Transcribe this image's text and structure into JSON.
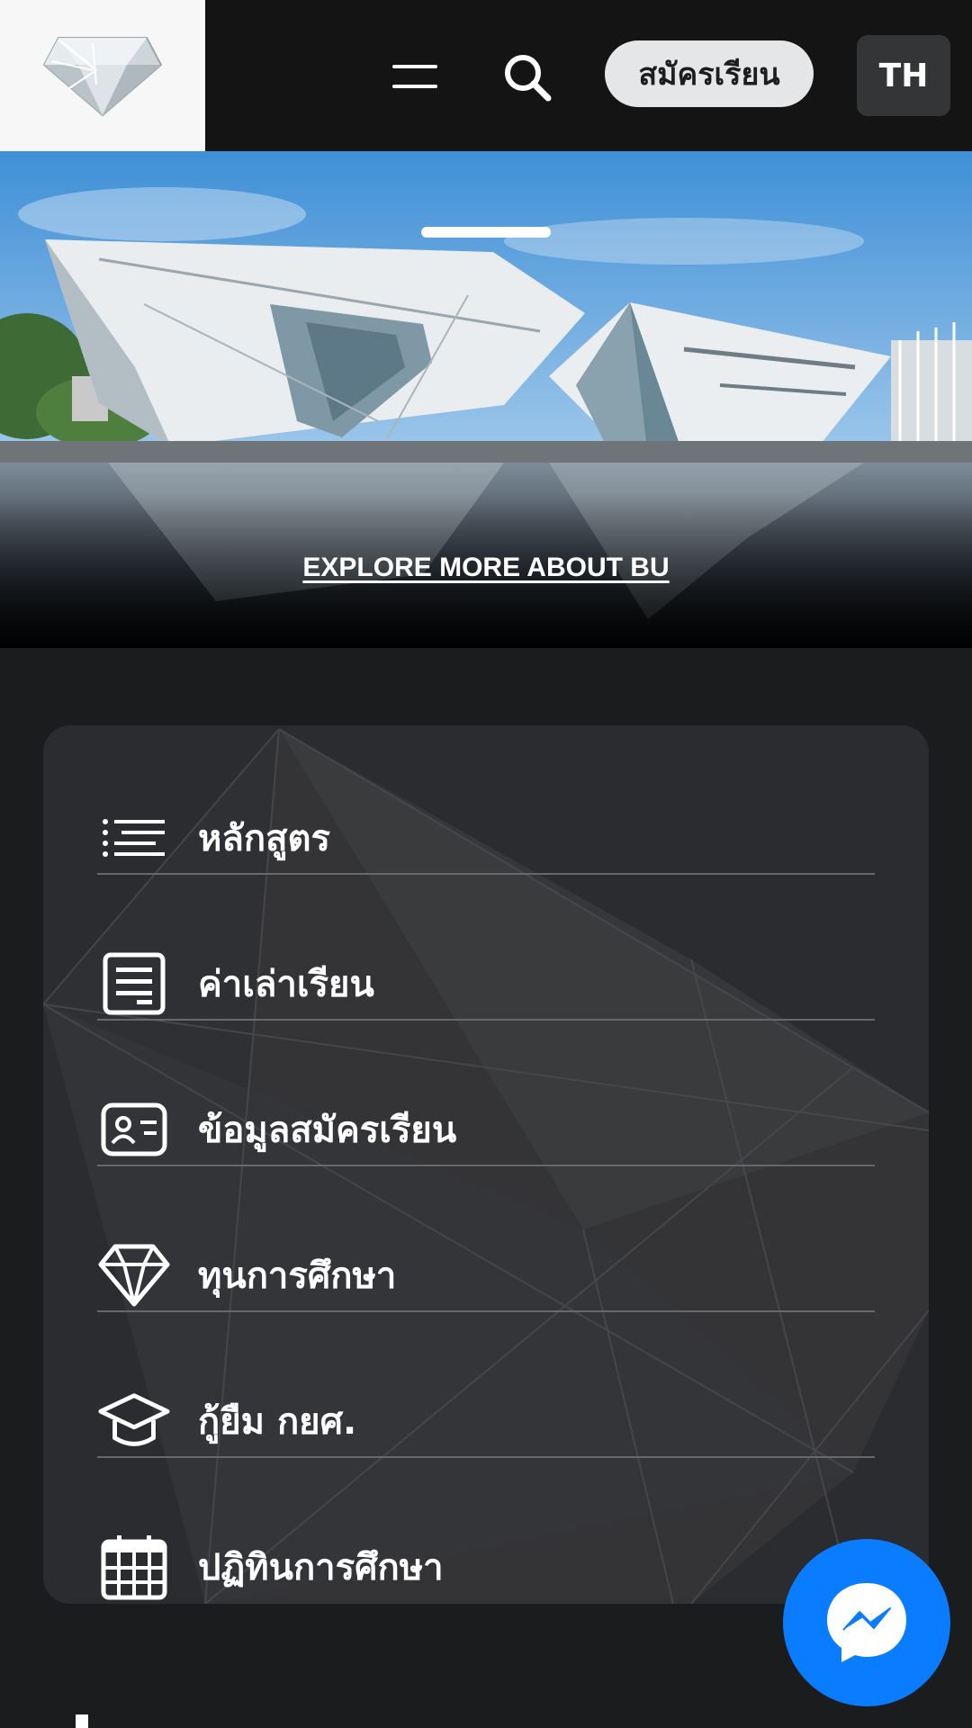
{
  "header": {
    "logo": "diamond-logo-icon",
    "menu_icon": "hamburger-menu-icon",
    "search_icon": "search-icon",
    "apply_label": "สมัครเรียน",
    "lang_label": "TH"
  },
  "hero": {
    "explore_label": "EXPLORE MORE ABOUT BU",
    "active_slide": 1
  },
  "quick_menu": {
    "items": [
      {
        "label": "หลักสูตร",
        "icon": "list-icon"
      },
      {
        "label": "ค่าเล่าเรียน",
        "icon": "document-icon"
      },
      {
        "label": "ข้อมูลสมัครเรียน",
        "icon": "id-card-icon"
      },
      {
        "label": "ทุนการศึกษา",
        "icon": "diamond-icon"
      },
      {
        "label": "กู้ยืม กยศ.",
        "icon": "graduation-cap-icon"
      },
      {
        "label": "ปฏิทินการศึกษา",
        "icon": "calendar-icon"
      }
    ]
  },
  "messenger": {
    "icon": "messenger-icon"
  },
  "colors": {
    "header_bg": "#141414",
    "page_bg": "#1b1c1e",
    "card_bg": "#2b2c2f",
    "messenger_blue": "#0a7cff",
    "apply_bg": "#e4e6e8"
  }
}
